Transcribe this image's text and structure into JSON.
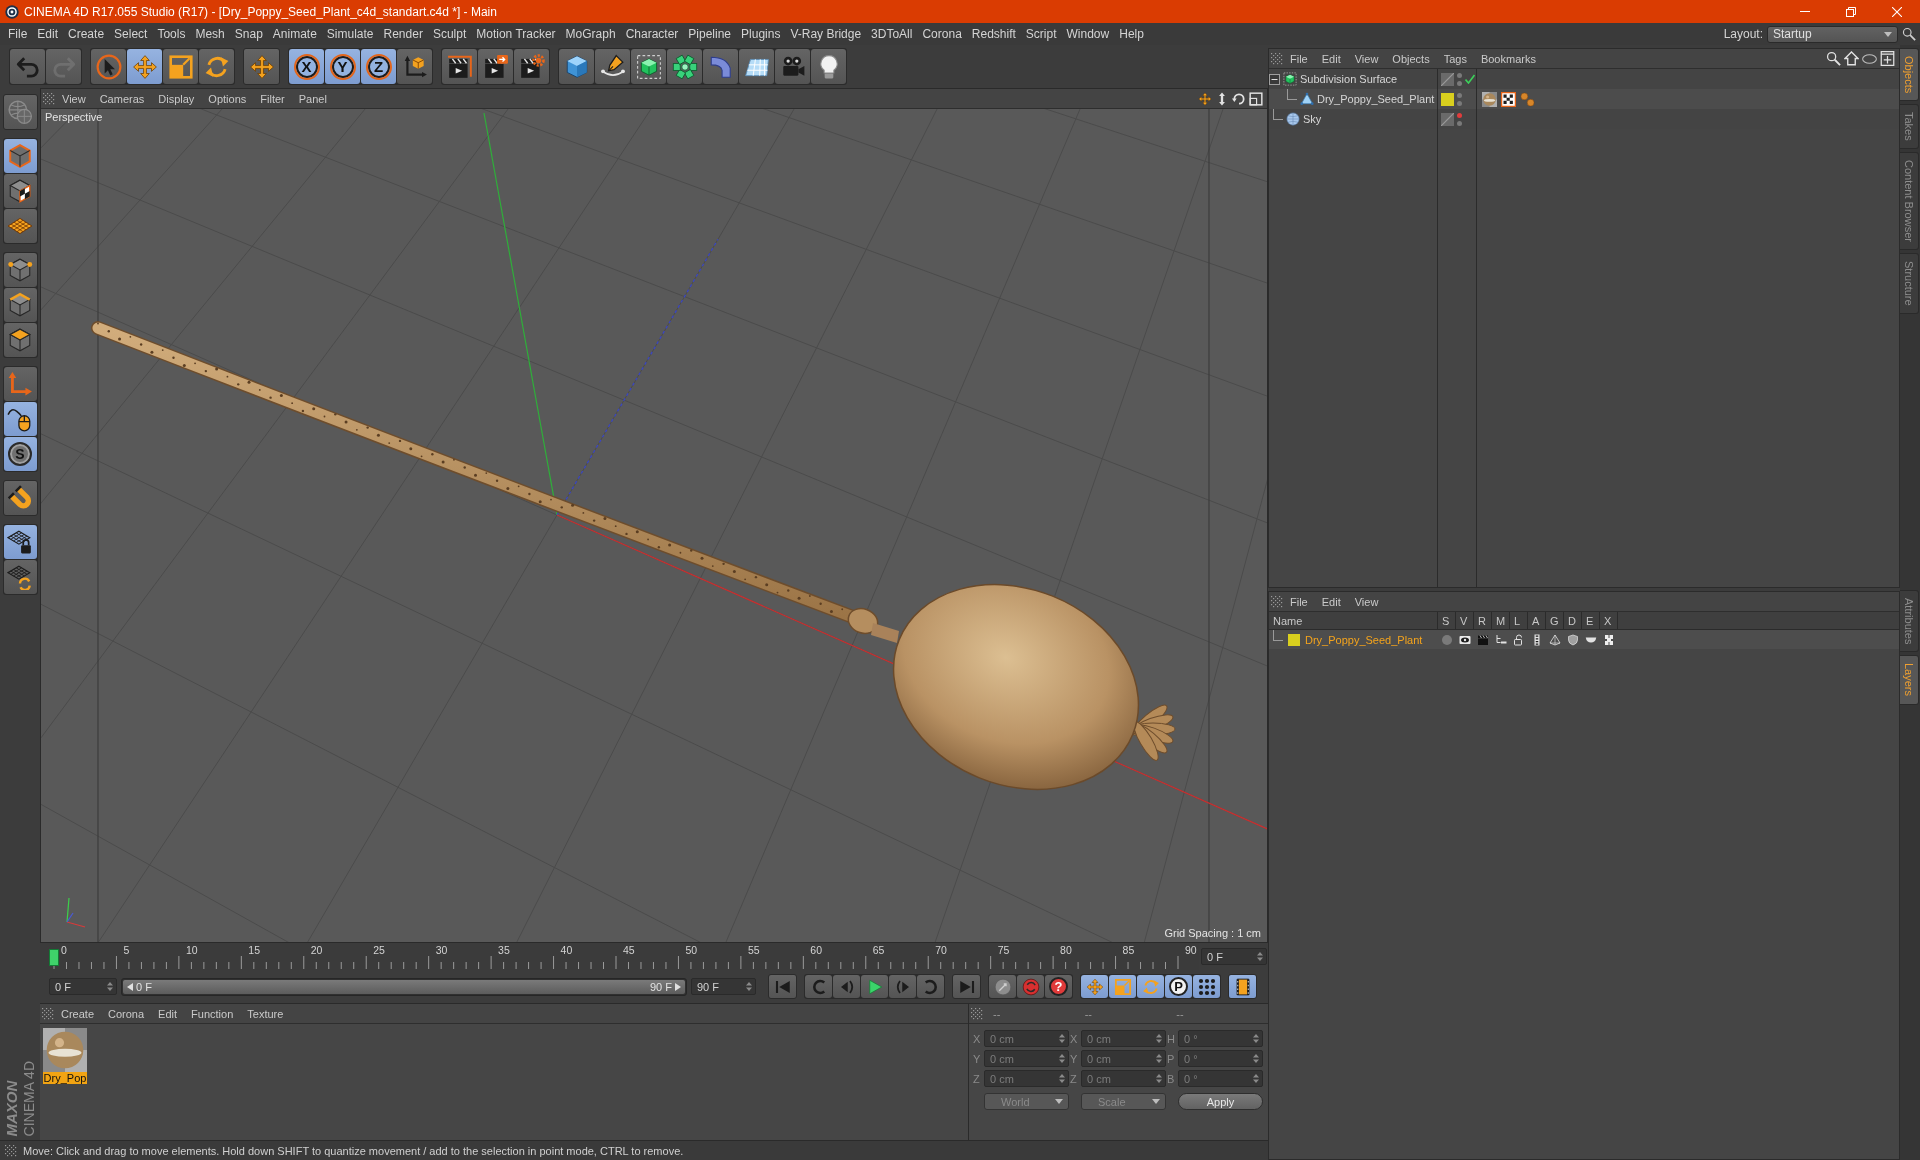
{
  "window": {
    "title": "CINEMA 4D R17.055 Studio (R17) - [Dry_Poppy_Seed_Plant_c4d_standart.c4d *] - Main"
  },
  "menu_bar": {
    "items": [
      "File",
      "Edit",
      "Create",
      "Select",
      "Tools",
      "Mesh",
      "Snap",
      "Animate",
      "Simulate",
      "Render",
      "Sculpt",
      "Motion Tracker",
      "MoGraph",
      "Character",
      "Pipeline",
      "Plugins",
      "V-Ray Bridge",
      "3DToAll",
      "Corona",
      "Redshift",
      "Script",
      "Window",
      "Help"
    ],
    "layout_label": "Layout:",
    "layout_value": "Startup"
  },
  "toolbar": {
    "groups": [
      {
        "tools": [
          {
            "kind": "undo",
            "active": false,
            "disabled": false
          },
          {
            "kind": "redo",
            "active": false,
            "disabled": true
          }
        ]
      },
      {
        "tools": [
          {
            "kind": "select",
            "active": false,
            "disabled": false
          },
          {
            "kind": "move",
            "active": true,
            "disabled": false
          },
          {
            "kind": "scale",
            "active": false,
            "disabled": false
          },
          {
            "kind": "rotate",
            "active": false,
            "disabled": false
          }
        ]
      },
      {
        "tools": [
          {
            "kind": "recent",
            "active": false,
            "disabled": false
          }
        ]
      },
      {
        "tools": [
          {
            "kind": "axis",
            "label": "X",
            "active": true,
            "disabled": false
          },
          {
            "kind": "axis",
            "label": "Y",
            "active": true,
            "disabled": false
          },
          {
            "kind": "axis",
            "label": "Z",
            "active": true,
            "disabled": false
          },
          {
            "kind": "coordinates",
            "active": false,
            "disabled": false
          }
        ]
      },
      {
        "tools": [
          {
            "kind": "renderview",
            "active": false,
            "disabled": false
          },
          {
            "kind": "renderpicture",
            "active": false,
            "disabled": false
          },
          {
            "kind": "rendersettings",
            "active": false,
            "disabled": false
          }
        ]
      },
      {
        "tools": [
          {
            "kind": "cube",
            "active": false,
            "disabled": false
          },
          {
            "kind": "spline",
            "active": false,
            "disabled": false
          },
          {
            "kind": "subdivision",
            "active": false,
            "disabled": false
          },
          {
            "kind": "cloner",
            "active": false,
            "disabled": false
          },
          {
            "kind": "deformer",
            "active": false,
            "disabled": false
          },
          {
            "kind": "floor",
            "active": false,
            "disabled": false
          },
          {
            "kind": "camera",
            "active": false,
            "disabled": false
          },
          {
            "kind": "light",
            "active": false,
            "disabled": false
          }
        ]
      }
    ]
  },
  "left_toolbar": {
    "groups": [
      {
        "tools": [
          {
            "kind": "makeeditable",
            "active": false,
            "disabled": true
          }
        ]
      },
      {
        "tools": [
          {
            "kind": "model",
            "active": true,
            "disabled": false
          },
          {
            "kind": "texture",
            "active": false,
            "disabled": false
          },
          {
            "kind": "workplane",
            "active": false,
            "disabled": false
          }
        ]
      },
      {
        "tools": [
          {
            "kind": "points",
            "active": false,
            "disabled": false
          },
          {
            "kind": "edges",
            "active": false,
            "disabled": false
          },
          {
            "kind": "polygons",
            "active": false,
            "disabled": false
          }
        ]
      },
      {
        "tools": [
          {
            "kind": "axismode",
            "active": false,
            "disabled": false
          },
          {
            "kind": "tweak",
            "active": true,
            "disabled": false
          },
          {
            "kind": "solo",
            "label": "S",
            "active": true,
            "disabled": false
          }
        ]
      },
      {
        "tools": [
          {
            "kind": "magnet",
            "active": false,
            "disabled": false
          }
        ]
      },
      {
        "tools": [
          {
            "kind": "gridlock",
            "active": true,
            "disabled": false
          },
          {
            "kind": "gridrotate",
            "active": false,
            "disabled": false
          }
        ]
      }
    ],
    "logo": {
      "brand": "MAXON",
      "product": "CINEMA 4D"
    }
  },
  "viewport": {
    "menu": [
      "View",
      "Cameras",
      "Display",
      "Options",
      "Filter",
      "Panel"
    ],
    "camera": "Perspective",
    "grid_spacing": "Grid Spacing : 1 cm"
  },
  "timeline": {
    "ticks": [
      "0",
      "5",
      "10",
      "15",
      "20",
      "25",
      "30",
      "35",
      "40",
      "45",
      "50",
      "55",
      "60",
      "65",
      "70",
      "75",
      "80",
      "85",
      "90"
    ],
    "playhead": {
      "level": 0
    },
    "current_frame": "0 F",
    "start_frame": "0 F",
    "range": {
      "start": "0 F",
      "end": "90 F",
      "level": 1
    },
    "end_frame": "90 F",
    "groups": [
      {
        "buttons": [
          {
            "kind": "start",
            "active": false
          }
        ]
      },
      {
        "buttons": [
          {
            "kind": "prevkey",
            "active": false
          },
          {
            "kind": "prevframe",
            "active": false
          },
          {
            "kind": "play",
            "active": false
          },
          {
            "kind": "nextframe",
            "active": false
          },
          {
            "kind": "nextkey",
            "active": false
          }
        ]
      },
      {
        "buttons": [
          {
            "kind": "end",
            "active": false
          }
        ]
      },
      {
        "buttons": [
          {
            "kind": "record",
            "active": false
          },
          {
            "kind": "autokey",
            "active": false
          },
          {
            "kind": "keyselection",
            "label": "?",
            "active": false
          }
        ]
      },
      {
        "buttons": [
          {
            "kind": "keymove",
            "active": true
          },
          {
            "kind": "keyscale",
            "active": true
          },
          {
            "kind": "keyrotate",
            "active": true
          },
          {
            "kind": "keyparam",
            "label": "P",
            "active": true
          },
          {
            "kind": "keypla",
            "active": true
          }
        ]
      },
      {
        "buttons": [
          {
            "kind": "timeline",
            "active": true
          }
        ]
      }
    ]
  },
  "materials": {
    "menu": [
      "Create",
      "Corona",
      "Edit",
      "Function",
      "Texture"
    ],
    "items": [
      {
        "name": "Dry_Pop",
        "selected": true
      }
    ]
  },
  "coordinates": {
    "headers": [
      "--",
      "--",
      "--"
    ],
    "disabled": true,
    "rows": [
      {
        "axis": "X",
        "position": "0 cm",
        "size_axis": "X",
        "size": "0 cm",
        "rotation_axis": "H",
        "rotation": "0 °"
      },
      {
        "axis": "Y",
        "position": "0 cm",
        "size_axis": "Y",
        "size": "0 cm",
        "rotation_axis": "P",
        "rotation": "0 °"
      },
      {
        "axis": "Z",
        "position": "0 cm",
        "size_axis": "Z",
        "size": "0 cm",
        "rotation_axis": "B",
        "rotation": "0 °"
      }
    ],
    "position_mode": "World",
    "size_mode": "Scale",
    "apply": "Apply"
  },
  "status_bar": {
    "text": "Move: Click and drag to move elements. Hold down SHIFT to quantize movement / add to the selection in point mode, CTRL to remove."
  },
  "object_manager": {
    "menu": [
      "File",
      "Edit",
      "View",
      "Objects",
      "Tags",
      "Bookmarks"
    ],
    "objects": [
      {
        "kind": "subdivision",
        "name": "Subdivision Surface",
        "expanded": true,
        "editor_hidden": false,
        "enabled": true,
        "children": [
          {
            "kind": "polygon",
            "name": "Dry_Poppy_Seed_Plant",
            "color": "#d9cf1e",
            "editor_hidden": false,
            "tags": [
              {
                "kind": "material"
              },
              {
                "kind": "uvw"
              },
              {
                "kind": "phong"
              }
            ]
          }
        ]
      },
      {
        "kind": "sky",
        "name": "Sky",
        "editor_hidden": true
      }
    ]
  },
  "layer_manager": {
    "menu": [
      "File",
      "Edit",
      "View"
    ],
    "columns": [
      "Name",
      "S",
      "V",
      "R",
      "M",
      "L",
      "A",
      "G",
      "D",
      "E",
      "X"
    ],
    "layers": [
      {
        "name": "Dry_Poppy_Seed_Plant",
        "color": "#d9cf1e",
        "selected": true
      }
    ]
  },
  "side_tabs": {
    "top": [
      {
        "label": "Objects",
        "selected": true
      },
      {
        "label": "Takes",
        "selected": false
      },
      {
        "label": "Content Browser",
        "selected": false
      },
      {
        "label": "Structure",
        "selected": false
      }
    ],
    "bottom": [
      {
        "label": "Attributes",
        "selected": false
      },
      {
        "label": "Layers",
        "selected": true
      }
    ]
  }
}
